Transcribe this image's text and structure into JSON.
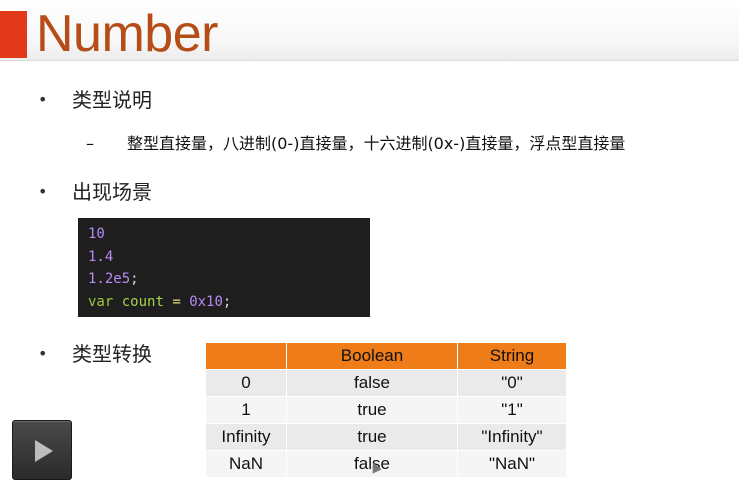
{
  "title": "Number",
  "sections": [
    {
      "bullet": "•",
      "heading": "类型说明"
    },
    {
      "bullet": "•",
      "heading": "出现场景"
    },
    {
      "bullet": "•",
      "heading": "类型转换"
    }
  ],
  "sub_item": {
    "dash": "–",
    "text": "整型直接量，八进制(0-)直接量，十六进制(0x-)直接量，浮点型直接量"
  },
  "code": {
    "line1": "10",
    "line2": "1.4",
    "line3_num": "1.2e5",
    "line3_punc": ";",
    "line4_kw": "var",
    "line4_ident": "count",
    "line4_op": "=",
    "line4_num": "0x10",
    "line4_punc": ";"
  },
  "table": {
    "headers": [
      "",
      "Boolean",
      "String"
    ],
    "rows": [
      [
        "0",
        "false",
        "\"0\""
      ],
      [
        "1",
        "true",
        "\"1\""
      ],
      [
        "Infinity",
        "true",
        "\"Infinity\""
      ],
      [
        "NaN",
        "false",
        "\"NaN\""
      ]
    ]
  },
  "colors": {
    "accent": "#e2391b",
    "title": "#b64c17",
    "table_header": "#ee7c18",
    "code_bg": "#1e1e1e"
  },
  "icons": {
    "player": "play-icon"
  }
}
